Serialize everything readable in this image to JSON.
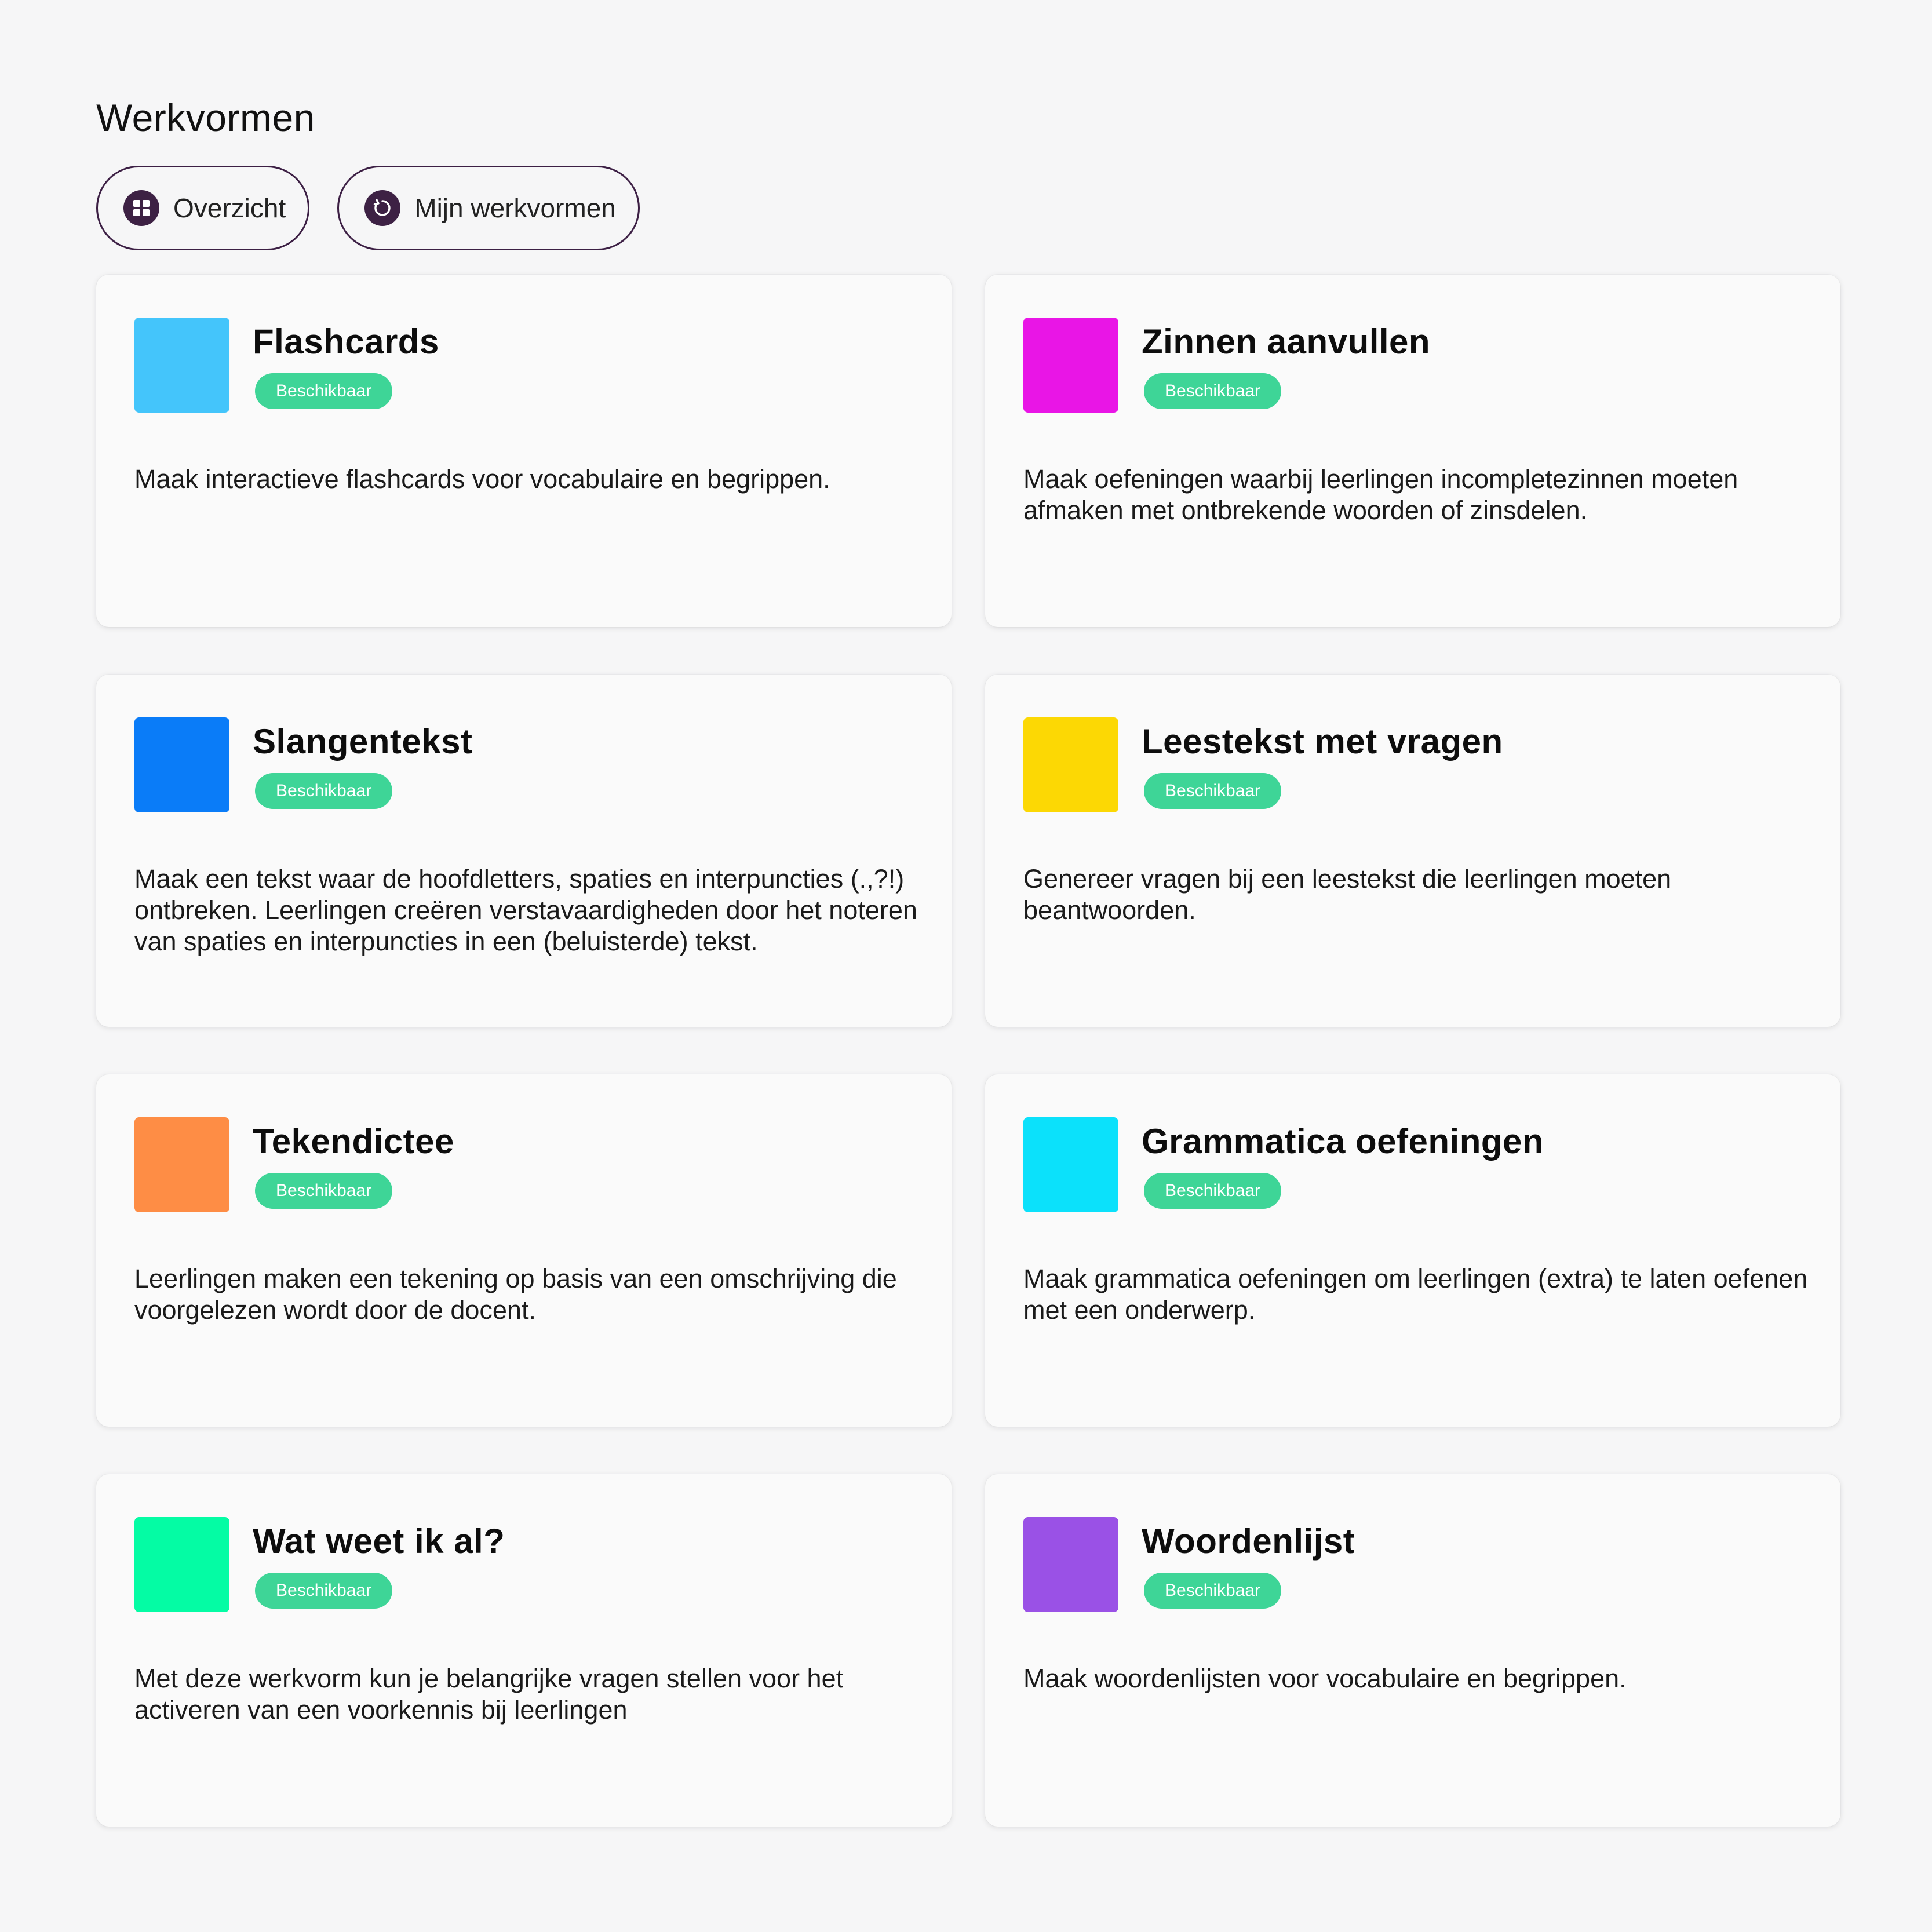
{
  "page": {
    "title": "Werkvormen"
  },
  "nav": [
    {
      "label": "Overzicht",
      "icon": "grid-icon"
    },
    {
      "label": "Mijn werkvormen",
      "icon": "refresh-icon"
    }
  ],
  "colors": {
    "badge": "#3ed597",
    "nav_icon_bg": "#3d2144",
    "nav_border": "#3c1f44"
  },
  "cards": [
    {
      "title": "Flashcards",
      "badge": "Beschikbaar",
      "description": "Maak interactieve flashcards voor vocabulaire en begrippen.",
      "color": "#44c5fb"
    },
    {
      "title": "Zinnen aanvullen",
      "badge": "Beschikbaar",
      "description": "Maak oefeningen waarbij leerlingen incompletezinnen moeten afmaken met ontbrekende woorden of zinsdelen.",
      "color": "#e915e6"
    },
    {
      "title": "Slangentekst",
      "badge": "Beschikbaar",
      "description": "Maak een tekst waar de hoofdletters, spaties en interpuncties (.,?!) ontbreken. Leerlingen creëren verstavaardigheden door het noteren van spaties en interpuncties in een (beluisterde) tekst.",
      "color": "#0a7cf8"
    },
    {
      "title": "Leestekst met vragen",
      "badge": "Beschikbaar",
      "description": "Genereer vragen bij een leestekst die leerlingen moeten beantwoorden.",
      "color": "#fcd804"
    },
    {
      "title": "Tekendictee",
      "badge": "Beschikbaar",
      "description": "Leerlingen maken een tekening op basis van een omschrijving die voorgelezen wordt door de docent.",
      "color": "#fe8d45"
    },
    {
      "title": "Grammatica oefeningen",
      "badge": "Beschikbaar",
      "description": "Maak grammatica oefeningen om leerlingen (extra) te laten oefenen met een onderwerp.",
      "color": "#0be1fb"
    },
    {
      "title": "Wat weet ik al?",
      "badge": "Beschikbaar",
      "description": "Met deze werkvorm kun je belangrijke vragen stellen voor het activeren van een voorkennis bij leerlingen",
      "color": "#04fca4"
    },
    {
      "title": "Woordenlijst",
      "badge": "Beschikbaar",
      "description": "Maak woordenlijsten voor vocabulaire en begrippen.",
      "color": "#9a51e6"
    }
  ]
}
